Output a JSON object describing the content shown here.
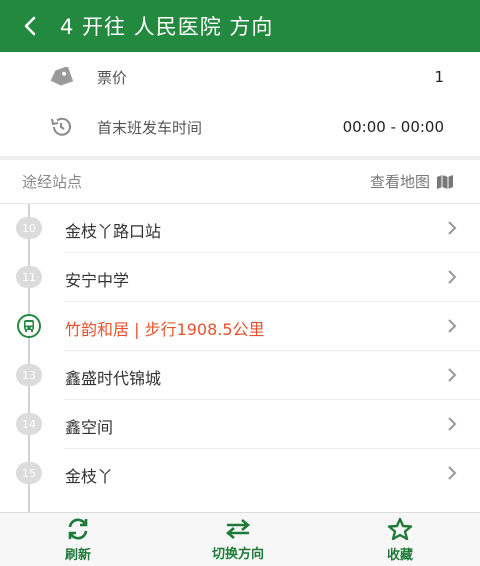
{
  "header": {
    "title": "4 开往 人民医院 方向"
  },
  "info": {
    "fare_label": "票价",
    "fare_value": "1",
    "time_label": "首末班发车时间",
    "time_value": "00:00 - 00:00"
  },
  "stops_section": {
    "title": "途经站点",
    "map_link": "查看地图"
  },
  "stops": [
    {
      "num": "10",
      "name": "金枝丫路口站"
    },
    {
      "num": "11",
      "name": "安宁中学"
    },
    {
      "num": "",
      "name": "竹韵和居 | 步行1908.5公里",
      "current": true
    },
    {
      "num": "13",
      "name": "鑫盛时代锦城"
    },
    {
      "num": "14",
      "name": "鑫空间"
    },
    {
      "num": "15",
      "name": "金枝丫"
    }
  ],
  "bottom": {
    "refresh_label": "刷新",
    "switch_label": "切换方向",
    "favorite_label": "收藏"
  },
  "colors": {
    "primary": "#22893f",
    "highlight": "#e5532e"
  },
  "icons": [
    "back-arrow-icon",
    "ticket-tag-icon",
    "clock-history-icon",
    "map-icon",
    "bus-icon",
    "chevron-right-icon",
    "refresh-icon",
    "switch-direction-icon",
    "star-icon"
  ]
}
